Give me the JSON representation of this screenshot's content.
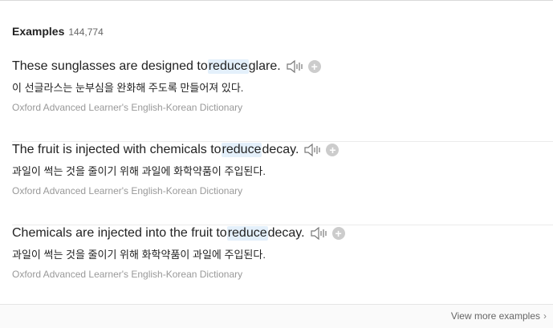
{
  "header": {
    "title": "Examples",
    "count": "144,774"
  },
  "examples": [
    {
      "before": "These sunglasses are designed to ",
      "keyword": "reduce",
      "after": " glare.",
      "translation": "이 선글라스는 눈부심을 완화해 주도록 만들어져 있다.",
      "source": "Oxford Advanced Learner's English-Korean Dictionary"
    },
    {
      "before": "The fruit is injected with chemicals to ",
      "keyword": "reduce",
      "after": " decay.",
      "translation": "과일이 썩는 것을 줄이기 위해 과일에 화학약품이 주입된다.",
      "source": "Oxford Advanced Learner's English-Korean Dictionary"
    },
    {
      "before": "Chemicals are injected into the fruit to ",
      "keyword": "reduce",
      "after": " decay.",
      "translation": "과일이 썩는 것을 줄이기 위해 화학약품이 과일에 주입된다.",
      "source": "Oxford Advanced Learner's English-Korean Dictionary"
    }
  ],
  "footer": {
    "view_more": "View more examples"
  },
  "icons": {
    "speaker": "speaker-icon",
    "add": "plus-circle-icon",
    "chevron": "chevron-right-icon"
  }
}
